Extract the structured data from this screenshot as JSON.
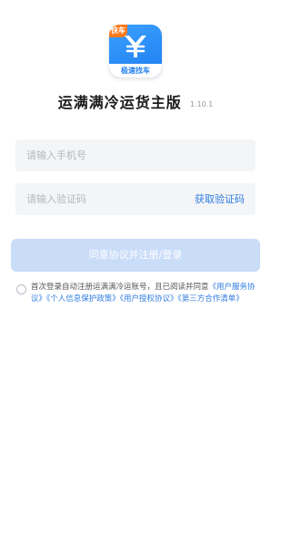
{
  "app_icon": {
    "badge": "快车",
    "caption": "极速找车"
  },
  "header": {
    "title": "运满满冷运货主版",
    "version": "1.10.1"
  },
  "form": {
    "phone_placeholder": "请输入手机号",
    "code_placeholder": "请输入验证码",
    "get_code_label": "获取验证码",
    "submit_label": "同意协议并注册/登录"
  },
  "agreement": {
    "text": "首次登录自动注册运满满冷运账号，且已阅读并同意",
    "links": [
      "《用户服务协议》",
      "《个人信息保护政策》",
      "《用户授权协议》",
      "《第三方合作清单》"
    ]
  },
  "colors": {
    "accent": "#2f7de1",
    "button_disabled": "#c9dcf8",
    "field_bg": "#f4f5f7",
    "icon_blue": "#1e7df0",
    "icon_badge": "#ff7a1a"
  }
}
